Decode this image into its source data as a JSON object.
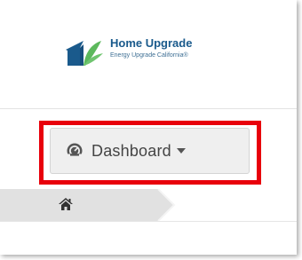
{
  "brand": {
    "name": "Home Upgrade",
    "tagline": "Energy Upgrade California®"
  },
  "nav": {
    "dashboard_label": "Dashboard",
    "dashboard_icon": "dashboard-gauge-icon",
    "highlight_color": "#e8000b"
  },
  "breadcrumb": {
    "home_icon": "home-icon"
  },
  "colors": {
    "brand_blue": "#1a5a8c",
    "brand_green": "#5cb85c",
    "button_bg": "#efefef"
  }
}
